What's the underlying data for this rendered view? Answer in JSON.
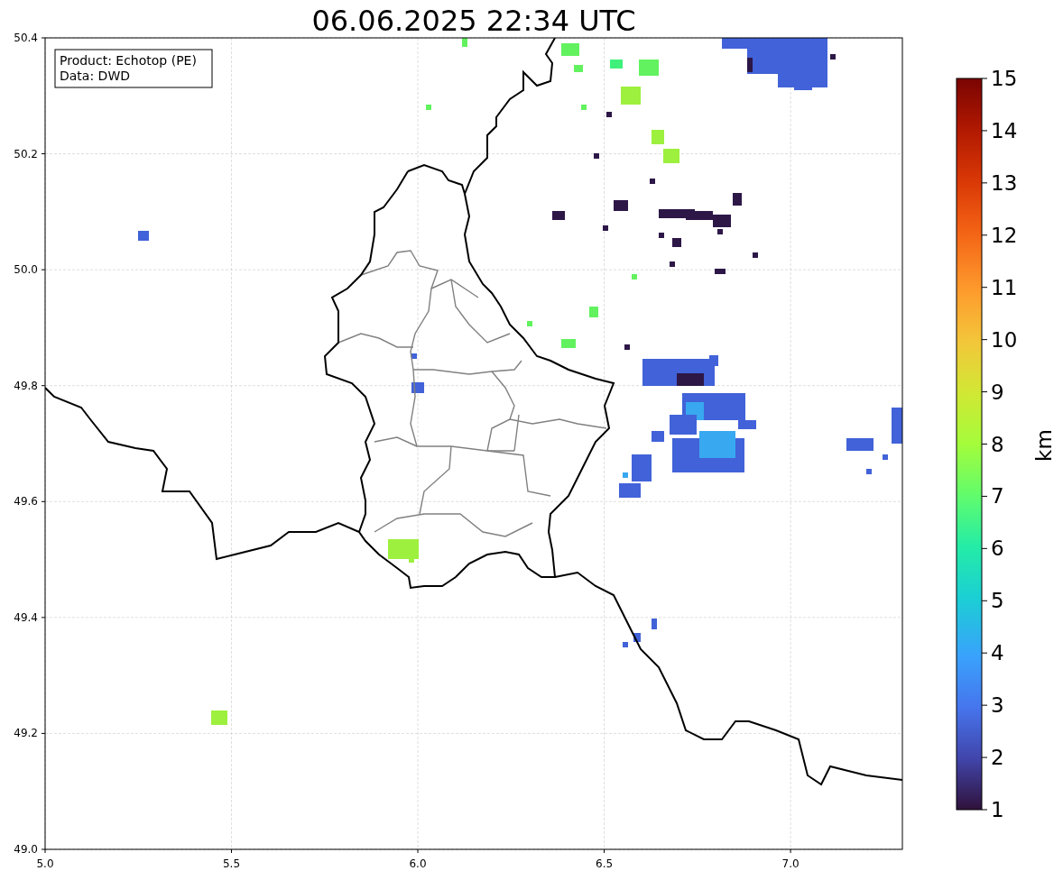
{
  "title": "06.06.2025 22:34 UTC",
  "info_box": [
    "Product: Echotop (PE)",
    "Data: DWD"
  ],
  "y_axis": {
    "ticks": [
      "50.4",
      "50.2",
      "50.0",
      "49.8",
      "49.6",
      "49.4",
      "49.2",
      "49.0"
    ]
  },
  "x_axis": {
    "ticks": [
      "5.0",
      "5.5",
      "6.0",
      "6.5",
      "7.0"
    ]
  },
  "colorbar": {
    "label": "km",
    "ticks": [
      "15",
      "14",
      "13",
      "12",
      "11",
      "10",
      "9",
      "8",
      "7",
      "6",
      "5",
      "4",
      "3",
      "2",
      "1"
    ]
  }
}
